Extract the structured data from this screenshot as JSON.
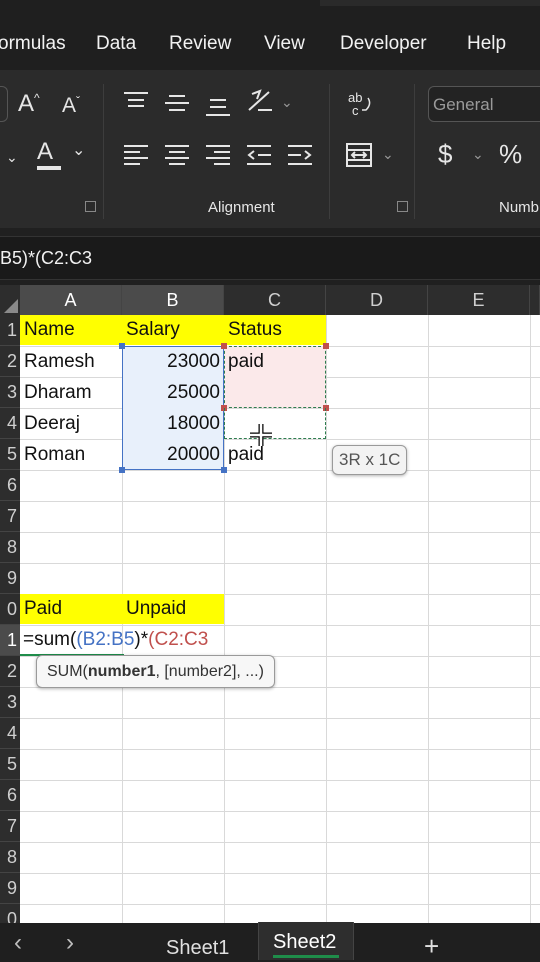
{
  "menu": {
    "items": [
      "ormulas",
      "Data",
      "Review",
      "View",
      "Developer",
      "Help"
    ]
  },
  "ribbon": {
    "alignment_label": "Alignment",
    "number_label": "Numb",
    "number_format": "General",
    "font_grow": "A",
    "font_shrink": "A",
    "font_color": "A",
    "currency": "$",
    "percent": "%"
  },
  "formula_bar": {
    "text": "B5)*(C2:C3"
  },
  "grid": {
    "columns": [
      "A",
      "B",
      "C",
      "D",
      "E"
    ],
    "rows": [
      "1",
      "2",
      "3",
      "4",
      "5",
      "6",
      "7",
      "8",
      "9",
      "0",
      "1",
      "2",
      "3",
      "4",
      "5",
      "6",
      "7",
      "8",
      "9",
      "0"
    ],
    "cells": {
      "a1": "Name",
      "b1": "Salary",
      "c1": "Status",
      "a2": "Ramesh",
      "b2": "23000",
      "c2": "paid",
      "a3": "Dharam",
      "b3": "25000",
      "a4": "Deeraj",
      "b4": "18000",
      "a5": "Roman",
      "b5": "20000",
      "c5": "paid",
      "a10": "Paid",
      "b10": "Unpaid"
    },
    "edit": {
      "prefix": "=sum(",
      "paren": "(",
      "range1": "B2:B5",
      "mid": ")*",
      "range2": "(C2:C3"
    },
    "size_tooltip": "3R x 1C",
    "fn_tooltip": {
      "name": "SUM(",
      "arg1": "number1",
      "rest": ", [number2], ...)"
    }
  },
  "tabs": {
    "sheet1": "Sheet1",
    "sheet2": "Sheet2",
    "add": "+",
    "prev": "‹",
    "next": "›"
  },
  "colors": {
    "accent_green": "#1f8d4a",
    "range_blue": "#4472c4",
    "range_red": "#c0504d",
    "header_yellow": "#ffff00"
  }
}
